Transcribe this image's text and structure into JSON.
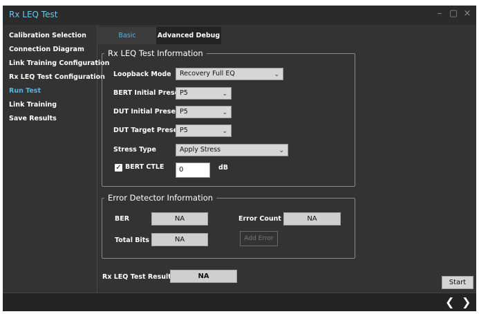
{
  "window": {
    "title": "Rx LEQ Test",
    "controls": {
      "minimize": "–",
      "maximize": "▢",
      "close": "×"
    }
  },
  "sidebar": {
    "items": [
      {
        "label": "Calibration Selection",
        "active": false
      },
      {
        "label": "Connection Diagram",
        "active": false
      },
      {
        "label": "Link Training Configuration",
        "active": false
      },
      {
        "label": "Rx LEQ Test Configuration",
        "active": false
      },
      {
        "label": "Run Test",
        "active": true
      },
      {
        "label": "Link Training",
        "active": false
      },
      {
        "label": "Save Results",
        "active": false
      }
    ]
  },
  "tabs": [
    {
      "label": "Basic",
      "active": true
    },
    {
      "label": "Advanced Debug",
      "active": false
    }
  ],
  "test_info": {
    "title": "Rx LEQ Test Information",
    "loopback_mode": {
      "label": "Loopback Mode",
      "value": "Recovery Full EQ"
    },
    "bert_initial_preset": {
      "label": "BERT Initial Preset",
      "value": "P5"
    },
    "dut_initial_preset": {
      "label": "DUT Initial Preset",
      "value": "P5"
    },
    "dut_target_preset": {
      "label": "DUT Target Preset",
      "value": "P5"
    },
    "stress_type": {
      "label": "Stress Type",
      "value": "Apply Stress"
    },
    "bert_ctle": {
      "label": "BERT CTLE",
      "checked": true,
      "check_glyph": "✓",
      "value": "0",
      "unit": "dB"
    }
  },
  "error_detector": {
    "title": "Error Detector Information",
    "ber": {
      "label": "BER",
      "value": "NA"
    },
    "error_count": {
      "label": "Error Count",
      "value": "NA"
    },
    "total_bits": {
      "label": "Total Bits",
      "value": "NA"
    },
    "add_error_label": "Add Error"
  },
  "result": {
    "label": "Rx LEQ Test Result",
    "value": "NA"
  },
  "start_label": "Start",
  "nav": {
    "prev": "❮",
    "next": "❯"
  },
  "chevron_glyph": "⌄",
  "colors": {
    "accent": "#4cb8e8",
    "background": "#333333",
    "title": "#6ec6f0"
  }
}
